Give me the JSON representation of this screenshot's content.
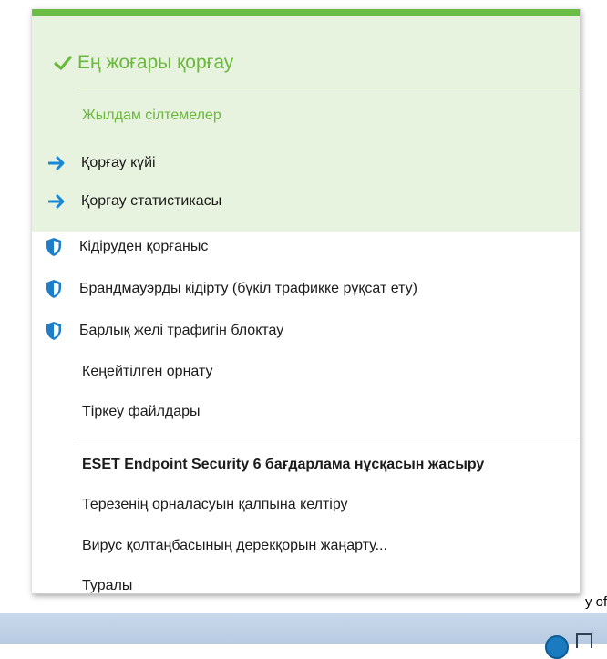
{
  "header": {
    "status": "Ең жоғары қорғау"
  },
  "quick_links": {
    "title": "Жылдам сілтемелер",
    "items": [
      {
        "label": "Қорғау күйі"
      },
      {
        "label": "Қорғау статистикасы"
      }
    ]
  },
  "actions": [
    {
      "label": "Кідіруден қорғаныс",
      "icon": "shield-icon"
    },
    {
      "label": "Брандмауэрды кідірту (бүкіл трафикке рұқсат ету)",
      "icon": "shield-icon"
    },
    {
      "label": "Барлық желі трафигін блоктау",
      "icon": "shield-icon"
    },
    {
      "label": "Кеңейтілген орнату"
    },
    {
      "label": "Тіркеу файлдары"
    }
  ],
  "program": [
    {
      "label": "ESET Endpoint Security 6 бағдарлама нұсқасын жасыру"
    },
    {
      "label": "Терезенің орналасуын қалпына келтіру"
    },
    {
      "label": "Вирус қолтаңбасының дерекқорын жаңарту..."
    },
    {
      "label": "Туралы"
    }
  ],
  "background": {
    "partial_text": "y of"
  },
  "colors": {
    "accent_green": "#6ab83c",
    "green_bg": "#e8f3df",
    "arrow_blue": "#1a88d4",
    "shield_blue": "#1f7ec9"
  }
}
